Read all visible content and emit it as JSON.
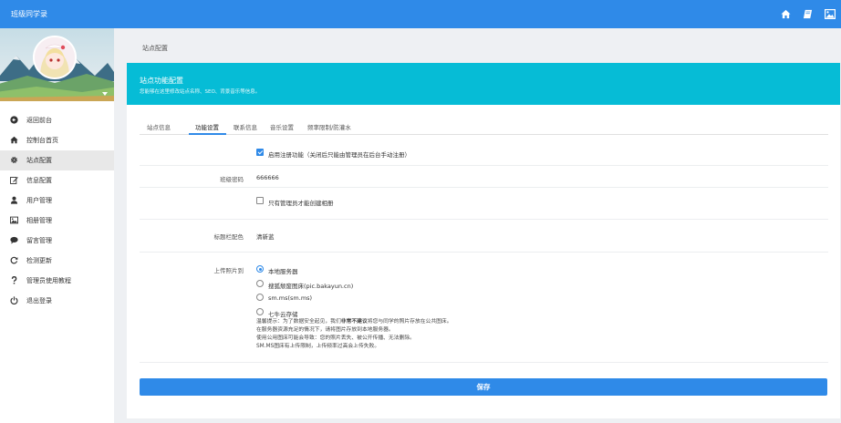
{
  "header": {
    "title": "班级同学录",
    "icons": [
      "home-icon",
      "book-icon",
      "image-icon"
    ]
  },
  "sidebar": {
    "items": [
      {
        "label": "返回前台",
        "icon": "arrow-left-circle-icon"
      },
      {
        "label": "控制台首页",
        "icon": "home-icon"
      },
      {
        "label": "站点配置",
        "icon": "gear-icon"
      },
      {
        "label": "信息配置",
        "icon": "edit-icon"
      },
      {
        "label": "用户管理",
        "icon": "user-icon"
      },
      {
        "label": "相册管理",
        "icon": "image-icon"
      },
      {
        "label": "留言管理",
        "icon": "comment-icon"
      },
      {
        "label": "检测更新",
        "icon": "refresh-icon"
      },
      {
        "label": "管理员使用教程",
        "icon": "question-icon"
      },
      {
        "label": "退出登录",
        "icon": "power-icon"
      }
    ],
    "active_index": 2
  },
  "breadcrumb": "站点配置",
  "card": {
    "title": "站点功能配置",
    "subtitle": "您能够在这里修改站点名称、SEO、背景音乐等信息。"
  },
  "tabs": [
    "站点信息",
    "功能设置",
    "联系信息",
    "音乐设置",
    "频率限制/防灌水"
  ],
  "active_tab": 1,
  "form": {
    "register_label": "启用注册功能（关闭后只能由管理员在后台手动注册）",
    "register_checked": true,
    "class_password_label": "班级密码",
    "class_password_value": "666666",
    "admin_album_label": "只有管理员才能创建相册",
    "admin_album_checked": false,
    "title_color_label": "标题栏配色",
    "title_color_value": "清新蓝",
    "upload_label": "上传照片到",
    "upload_options": [
      "本地服务器",
      "搜狐颓废图床(pic.bakayun.cn)",
      "sm.ms(sm.ms)",
      "七牛云存储"
    ],
    "upload_selected": 0,
    "notice_prefix": "温馨提示：为了数据安全起见，我们",
    "notice_bold": "非常不建议",
    "notice_suffix": "将您与同学的照片存放在公共图床。",
    "notice_lines": [
      "在服务器资源充足的情况下，请将图片存放到本地服务器。",
      "使用公用图床可能会导致：您的照片丢失、被公开传播、无法删除。",
      "SM.MS图床有上传限制，上传频率过高会上传失败。"
    ]
  },
  "save_label": "保存",
  "colors": {
    "primary": "#2f8ae8",
    "card_header": "#06bcd6"
  }
}
